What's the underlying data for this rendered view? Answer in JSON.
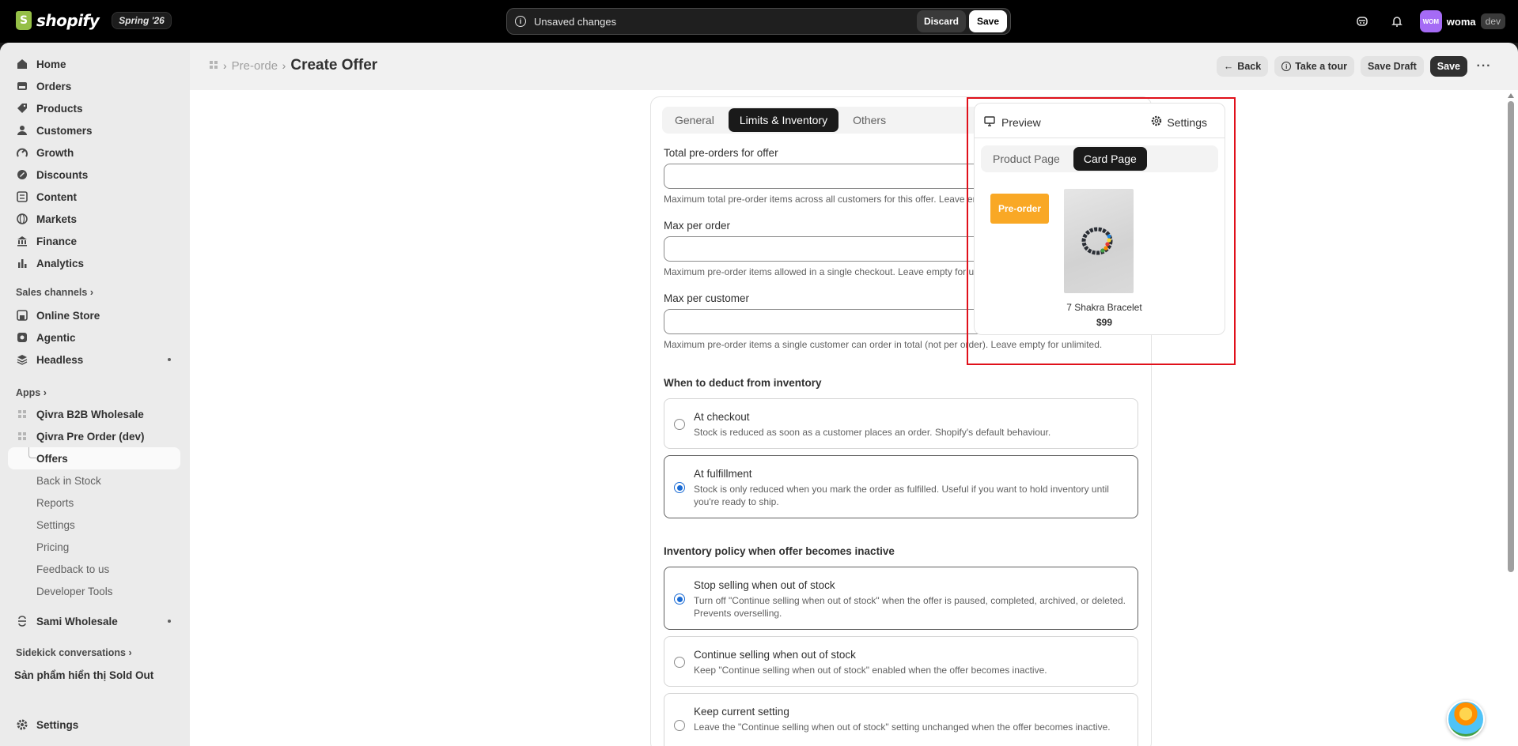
{
  "topbar": {
    "brand": "shopify",
    "edition": "Spring '26",
    "unsaved_message": "Unsaved changes",
    "discard_label": "Discard",
    "save_label": "Save",
    "avatar_initials": "WOM",
    "store_name": "woma",
    "env_badge": "dev"
  },
  "sidebar": {
    "main_items": [
      {
        "label": "Home",
        "icon": "home-icon"
      },
      {
        "label": "Orders",
        "icon": "orders-icon"
      },
      {
        "label": "Products",
        "icon": "tag-icon"
      },
      {
        "label": "Customers",
        "icon": "person-icon"
      },
      {
        "label": "Growth",
        "icon": "growth-icon"
      },
      {
        "label": "Discounts",
        "icon": "discount-icon"
      },
      {
        "label": "Content",
        "icon": "content-icon"
      },
      {
        "label": "Markets",
        "icon": "globe-icon"
      },
      {
        "label": "Finance",
        "icon": "bank-icon"
      },
      {
        "label": "Analytics",
        "icon": "bar-chart-icon"
      }
    ],
    "sales_channels_heading": "Sales channels",
    "sales_channels": [
      {
        "label": "Online Store",
        "icon": "store-icon"
      },
      {
        "label": "Agentic",
        "icon": "agentic-icon"
      },
      {
        "label": "Headless",
        "icon": "headless-icon"
      }
    ],
    "apps_heading": "Apps",
    "apps": [
      {
        "label": "Qivra B2B Wholesale"
      },
      {
        "label": "Qivra Pre Order (dev)"
      }
    ],
    "app_subitems": [
      "Offers",
      "Back in Stock",
      "Reports",
      "Settings",
      "Pricing",
      "Feedback to us",
      "Developer Tools"
    ],
    "other_app": "Sami Wholesale",
    "sidekick_heading": "Sidekick conversations",
    "sidekick_item": "Sản phẩm hiển thị Sold Out",
    "settings_label": "Settings"
  },
  "header": {
    "breadcrumb_parent": "Pre-order",
    "title": "Create Offer",
    "back_label": "Back",
    "tour_label": "Take a tour",
    "save_draft_label": "Save Draft",
    "save_label": "Save",
    "more_label": "···"
  },
  "form": {
    "tabs": [
      "General",
      "Limits & Inventory",
      "Others"
    ],
    "active_tab": "Limits & Inventory",
    "fields": [
      {
        "label": "Total pre-orders for offer",
        "value": "",
        "help": "Maximum total pre-order items across all customers for this offer. Leave empty for unlimited."
      },
      {
        "label": "Max per order",
        "value": "",
        "help": "Maximum pre-order items allowed in a single checkout. Leave empty for unlimited."
      },
      {
        "label": "Max per customer",
        "value": "",
        "help": "Maximum pre-order items a single customer can order in total (not per order). Leave empty for unlimited."
      }
    ],
    "deduct_title": "When to deduct from inventory",
    "deduct_options": [
      {
        "title": "At checkout",
        "desc": "Stock is reduced as soon as a customer places an order. Shopify's default behaviour.",
        "selected": false
      },
      {
        "title": "At fulfillment",
        "desc": "Stock is only reduced when you mark the order as fulfilled. Useful if you want to hold inventory until you're ready to ship.",
        "selected": true
      }
    ],
    "policy_title": "Inventory policy when offer becomes inactive",
    "policy_options": [
      {
        "title": "Stop selling when out of stock",
        "desc": "Turn off \"Continue selling when out of stock\" when the offer is paused, completed, archived, or deleted. Prevents overselling.",
        "selected": true
      },
      {
        "title": "Continue selling when out of stock",
        "desc": "Keep \"Continue selling when out of stock\" enabled when the offer becomes inactive.",
        "selected": false
      },
      {
        "title": "Keep current setting",
        "desc": "Leave the \"Continue selling when out of stock\" setting unchanged when the offer becomes inactive.",
        "selected": false
      }
    ]
  },
  "preview": {
    "preview_label": "Preview",
    "settings_label": "Settings",
    "tabs": [
      "Product Page",
      "Card Page"
    ],
    "active_tab": "Card Page",
    "badge_label": "Pre-order",
    "product_name": "7 Shakra Bracelet",
    "product_price": "$99"
  },
  "colors": {
    "badge": "#f9a825",
    "highlight": "#e0101a",
    "radio_selected": "#1a6bd4"
  }
}
